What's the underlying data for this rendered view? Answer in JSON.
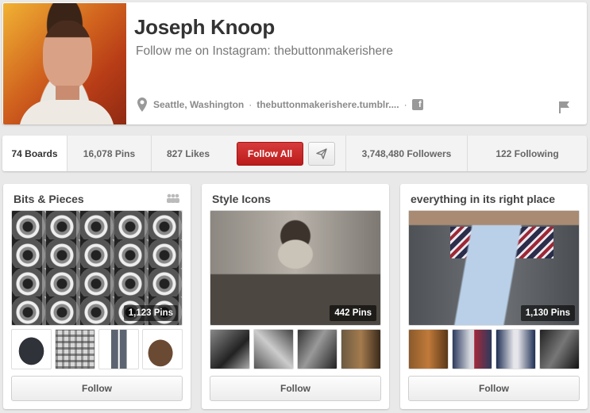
{
  "profile": {
    "name": "Joseph Knoop",
    "tagline": "Follow me on Instagram: thebuttonmakerishere",
    "location": "Seattle, Washington",
    "separator": "·",
    "website": "thebuttonmakerishere.tumblr....",
    "separator2": "·",
    "icons": {
      "location": "map-pin-icon",
      "facebook": "facebook-icon",
      "report": "flag-icon"
    }
  },
  "stats": {
    "boards": "74 Boards",
    "pins": "16,078 Pins",
    "likes": "827 Likes",
    "follow_all": "Follow All",
    "followers": "3,748,480 Followers",
    "following": "122 Following"
  },
  "boards": [
    {
      "title": "Bits & Pieces",
      "pin_count": "1,123 Pins",
      "follow_label": "Follow",
      "group_board": true
    },
    {
      "title": "Style Icons",
      "pin_count": "442 Pins",
      "follow_label": "Follow",
      "group_board": false
    },
    {
      "title": "everything in its right place",
      "pin_count": "1,130 Pins",
      "follow_label": "Follow",
      "group_board": false
    }
  ],
  "colors": {
    "accent": "#bb1b1b",
    "background": "#e9e9e9"
  }
}
